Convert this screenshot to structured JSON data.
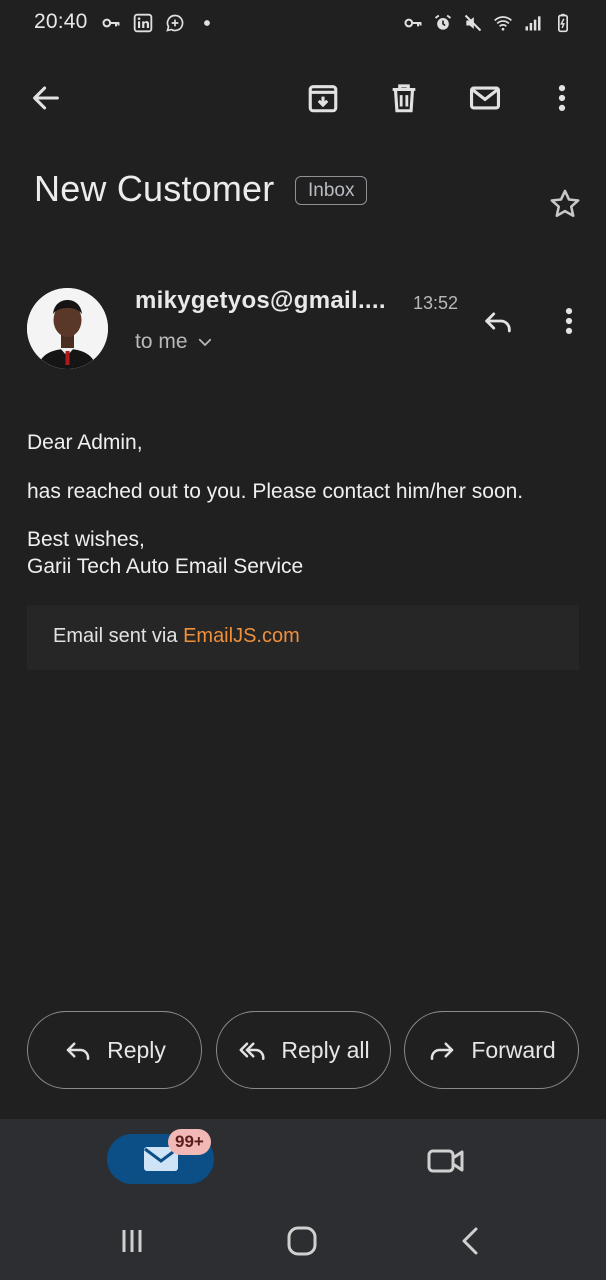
{
  "status_bar": {
    "time": "20:40",
    "left_icons": [
      "key-icon",
      "linkedin-icon",
      "whatsapp-business-icon",
      "dot-icon"
    ],
    "right_icons": [
      "vpn-key-icon",
      "alarm-icon",
      "mute-icon",
      "wifi-icon",
      "signal-icon",
      "battery-charging-icon"
    ]
  },
  "toolbar": {
    "icons": [
      "back-arrow-icon",
      "archive-icon",
      "delete-icon",
      "mark-unread-icon",
      "more-vert-icon"
    ]
  },
  "email": {
    "subject": "New Customer",
    "label": "Inbox",
    "sender": "mikygetyos@gmail....",
    "time": "13:52",
    "recipient": "to me",
    "greeting": "Dear Admin,",
    "message": "has reached out to you. Please contact him/her soon.",
    "closing_1": "Best wishes,",
    "closing_2": "Garii Tech Auto Email Service",
    "footer_prefix": "Email sent via ",
    "footer_link": "EmailJS.com"
  },
  "actions": {
    "reply": "Reply",
    "reply_all": "Reply all",
    "forward": "Forward"
  },
  "bottom_nav": {
    "mail_badge": "99+",
    "items": [
      "mail-icon",
      "video-call-icon"
    ]
  },
  "colors": {
    "background": "#202020",
    "link": "#f0903a",
    "nav_background": "#2d2e31",
    "active_pill": "#0b4f86",
    "badge": "#f2b8b5"
  }
}
